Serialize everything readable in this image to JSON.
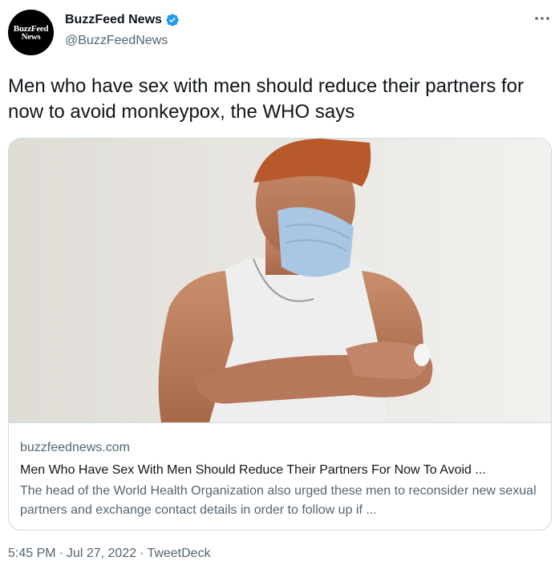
{
  "account": {
    "avatar_line1": "BuzzFeed",
    "avatar_line2": "News",
    "display_name": "BuzzFeed News",
    "handle": "@BuzzFeedNews",
    "verified": true
  },
  "tweet": {
    "text": "Men who have sex with men should reduce their partners for now to avoid monkeypox, the WHO says"
  },
  "card": {
    "domain": "buzzfeednews.com",
    "title": "Men Who Have Sex With Men Should Reduce Their Partners For Now To Avoid ...",
    "description": "The head of the World Health Organization also urged these men to reconsider new sexual partners and exchange contact details in order to follow up if ..."
  },
  "meta": {
    "time": "5:45 PM",
    "separator": "·",
    "date": "Jul 27, 2022",
    "source": "TweetDeck"
  },
  "colors": {
    "text_primary": "#0f1419",
    "text_secondary": "#536471",
    "verified_blue": "#1d9bf0",
    "border": "#cfd9de"
  },
  "icons": [
    "verified-badge-icon",
    "more-options-icon"
  ]
}
